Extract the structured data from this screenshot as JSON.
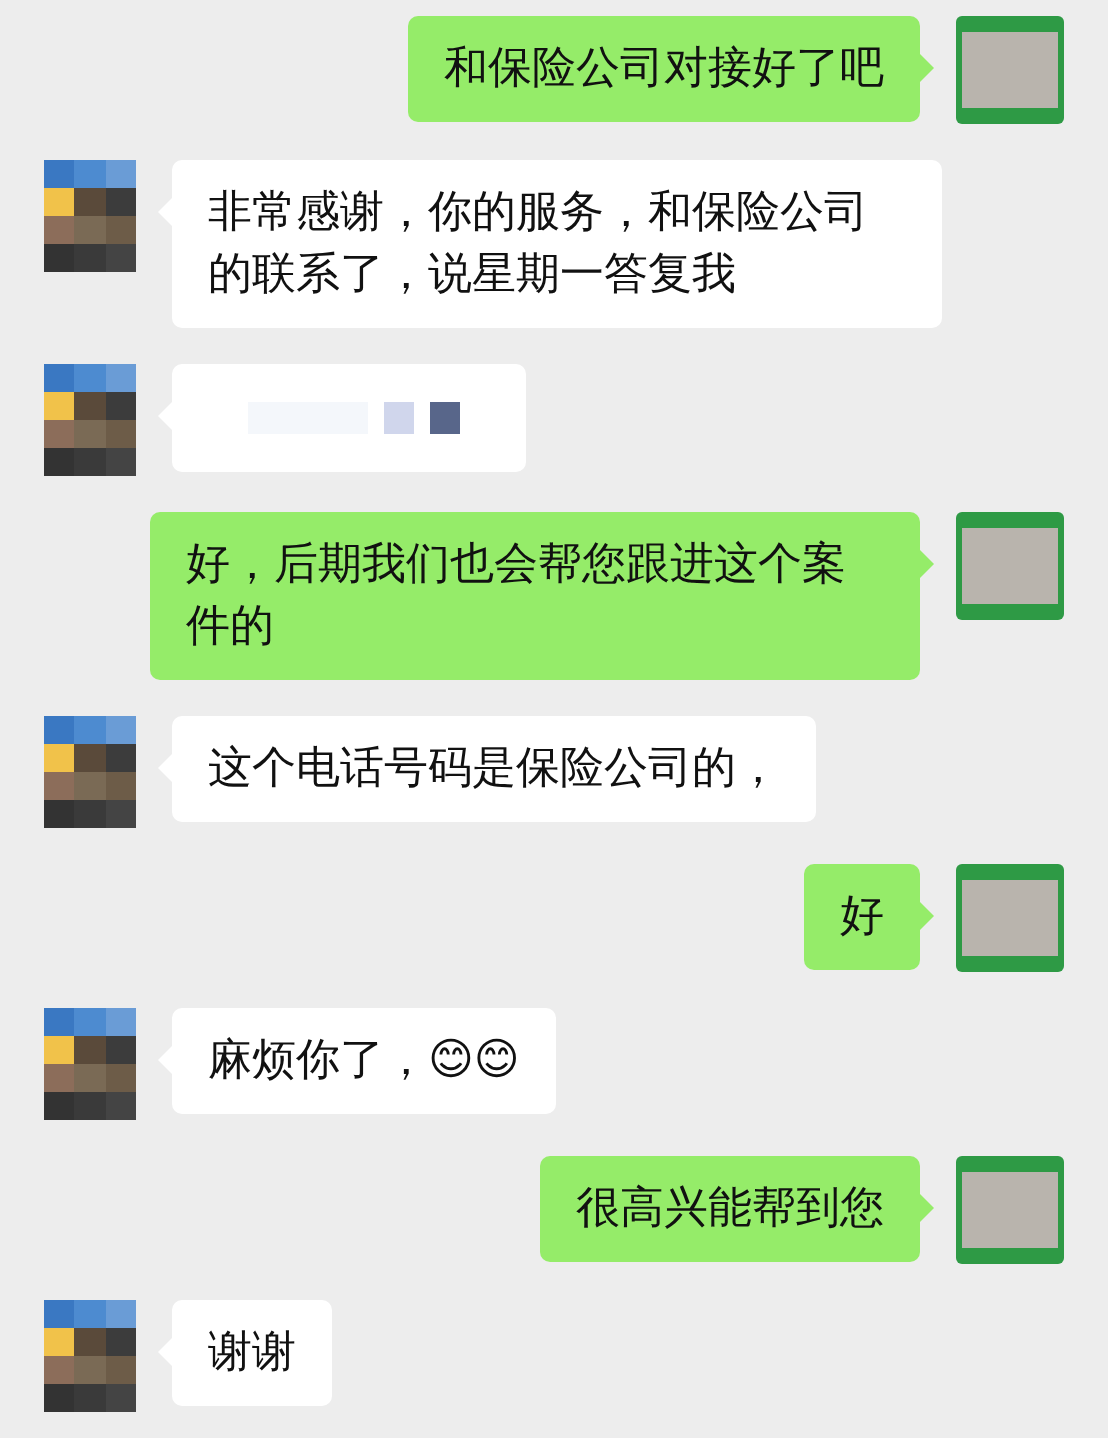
{
  "messages": [
    {
      "kind": "sent",
      "text": "和保险公司对接好了吧"
    },
    {
      "kind": "received",
      "text": "非常感谢，你的服务，和保险公司的联系了，说星期一答复我"
    },
    {
      "kind": "received_redacted"
    },
    {
      "kind": "sent",
      "text": "好，后期我们也会帮您跟进这个案件的"
    },
    {
      "kind": "received",
      "text": "这个电话号码是保险公司的，"
    },
    {
      "kind": "sent",
      "text": "好"
    },
    {
      "kind": "received",
      "text": "麻烦你了，😊😊"
    },
    {
      "kind": "sent",
      "text": "很高兴能帮到您"
    },
    {
      "kind": "received",
      "text": "谢谢"
    }
  ]
}
